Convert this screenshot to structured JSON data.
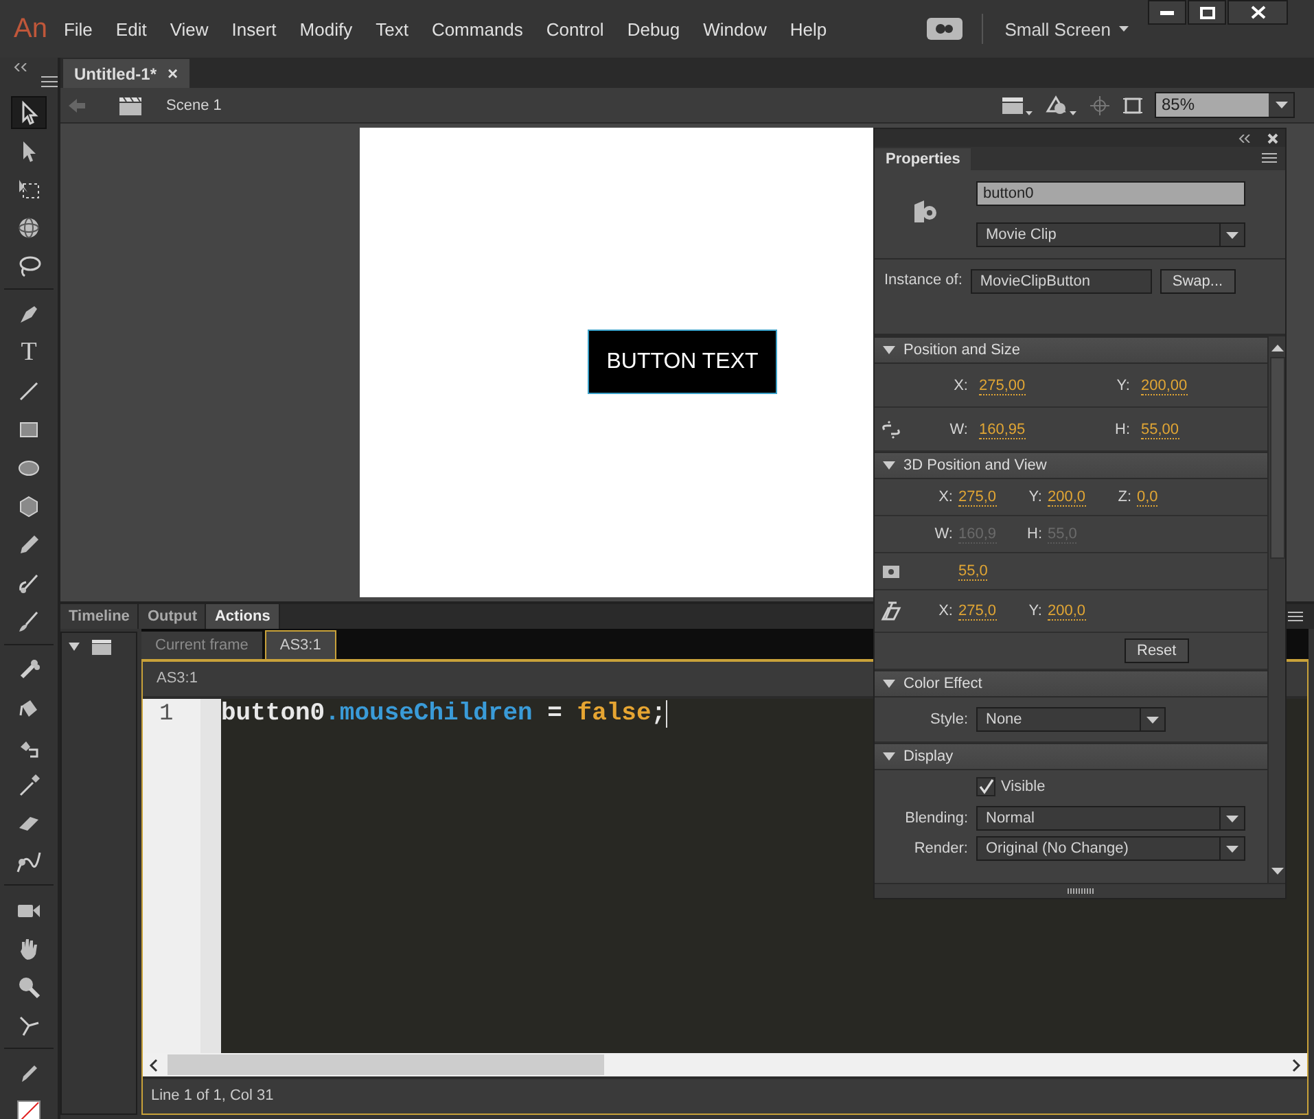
{
  "app": {
    "logo": "An",
    "workspace": "Small Screen"
  },
  "menu": [
    "File",
    "Edit",
    "View",
    "Insert",
    "Modify",
    "Text",
    "Commands",
    "Control",
    "Debug",
    "Window",
    "Help"
  ],
  "document_tabs": [
    {
      "label": "Untitled-1*",
      "close": "×",
      "selected": true
    }
  ],
  "edit_bar": {
    "scene": "Scene 1",
    "zoom": "85%"
  },
  "tool_groups": [
    [
      {
        "kind": "selection",
        "selected": true
      },
      {
        "kind": "subselection",
        "selected": false
      },
      {
        "kind": "free-transform",
        "selected": false
      },
      {
        "kind": "rotate-3d",
        "selected": false
      },
      {
        "kind": "lasso",
        "selected": false
      }
    ],
    [
      {
        "kind": "pen",
        "selected": false
      },
      {
        "kind": "text",
        "label": "T",
        "selected": false
      },
      {
        "kind": "line",
        "selected": false
      },
      {
        "kind": "rectangle",
        "selected": false
      },
      {
        "kind": "oval",
        "selected": false
      },
      {
        "kind": "polystar",
        "selected": false
      },
      {
        "kind": "pencil",
        "selected": false
      },
      {
        "kind": "paint-brush",
        "selected": false
      },
      {
        "kind": "brush",
        "selected": false
      }
    ],
    [
      {
        "kind": "bone",
        "selected": false
      },
      {
        "kind": "bucket",
        "selected": false
      },
      {
        "kind": "ink-bottle",
        "selected": false
      },
      {
        "kind": "eyedropper",
        "selected": false
      },
      {
        "kind": "eraser",
        "selected": false
      },
      {
        "kind": "width",
        "selected": false
      }
    ],
    [
      {
        "kind": "camera",
        "selected": false
      },
      {
        "kind": "hand",
        "selected": false
      },
      {
        "kind": "zoom",
        "selected": false
      },
      {
        "kind": "asset-warp",
        "selected": false
      }
    ],
    [
      {
        "kind": "stroke-color",
        "selected": false
      },
      {
        "kind": "fill-color",
        "selected": false
      }
    ]
  ],
  "stage": {
    "button_text": "BUTTON TEXT"
  },
  "bottom_panel": {
    "tabs": [
      {
        "label": "Timeline",
        "selected": false
      },
      {
        "label": "Output",
        "selected": false
      },
      {
        "label": "Actions",
        "selected": true
      }
    ],
    "script_tabs": [
      {
        "label": "Current frame",
        "selected": false
      },
      {
        "label": "AS3:1",
        "selected": true
      }
    ],
    "script_title": "AS3:1",
    "code_lines": [
      {
        "number": "1",
        "tokens": [
          {
            "text": "button0",
            "kind": "plain"
          },
          {
            "text": ".mouseChildren",
            "kind": "property"
          },
          {
            "text": " = ",
            "kind": "plain"
          },
          {
            "text": "false",
            "kind": "keyword"
          },
          {
            "text": ";",
            "kind": "plain"
          }
        ]
      }
    ],
    "status": "Line 1 of 1, Col 31"
  },
  "properties": {
    "title": "Properties",
    "instance_name": "button0",
    "symbol_type": "Movie Clip",
    "instance_of_label": "Instance of:",
    "instance_of": "MovieClipButton",
    "swap": "Swap...",
    "sections": [
      {
        "title": "Position and Size",
        "expanded": true,
        "rows": [
          {
            "kind": "fields",
            "fields": [
              {
                "label": "X:",
                "value": "275,00",
                "disabled": false
              },
              {
                "label": "Y:",
                "value": "200,00",
                "disabled": false
              }
            ]
          },
          {
            "kind": "linked-fields",
            "fields": [
              {
                "label": "W:",
                "value": "160,95",
                "disabled": false
              },
              {
                "label": "H:",
                "value": "55,00",
                "disabled": false
              }
            ]
          }
        ]
      },
      {
        "title": "3D Position and View",
        "expanded": true,
        "rows": [
          {
            "kind": "fields",
            "fields": [
              {
                "label": "X:",
                "value": "275,0",
                "disabled": false
              },
              {
                "label": "Y:",
                "value": "200,0",
                "disabled": false
              },
              {
                "label": "Z:",
                "value": "0,0",
                "disabled": false
              }
            ]
          },
          {
            "kind": "fields",
            "fields": [
              {
                "label": "W:",
                "value": "160,9",
                "disabled": true
              },
              {
                "label": "H:",
                "value": "55,0",
                "disabled": true
              }
            ]
          },
          {
            "kind": "perspective-fields",
            "fields": [
              {
                "value": "55,0",
                "disabled": false
              }
            ]
          },
          {
            "kind": "vanishing-fields",
            "fields": [
              {
                "label": "X:",
                "value": "275,0",
                "disabled": false
              },
              {
                "label": "Y:",
                "value": "200,0",
                "disabled": false
              }
            ]
          },
          {
            "kind": "button",
            "label": "Reset"
          }
        ]
      },
      {
        "title": "Color Effect",
        "expanded": true,
        "rows": [
          {
            "kind": "dropdown",
            "label": "Style:",
            "value": "None"
          }
        ]
      },
      {
        "title": "Display",
        "expanded": true,
        "rows": [
          {
            "kind": "checkbox",
            "label": "Visible",
            "checked": true
          },
          {
            "kind": "dropdown",
            "label": "Blending:",
            "value": "Normal"
          },
          {
            "kind": "dropdown",
            "label": "Render:",
            "value": "Original (No Change)"
          }
        ]
      }
    ]
  }
}
